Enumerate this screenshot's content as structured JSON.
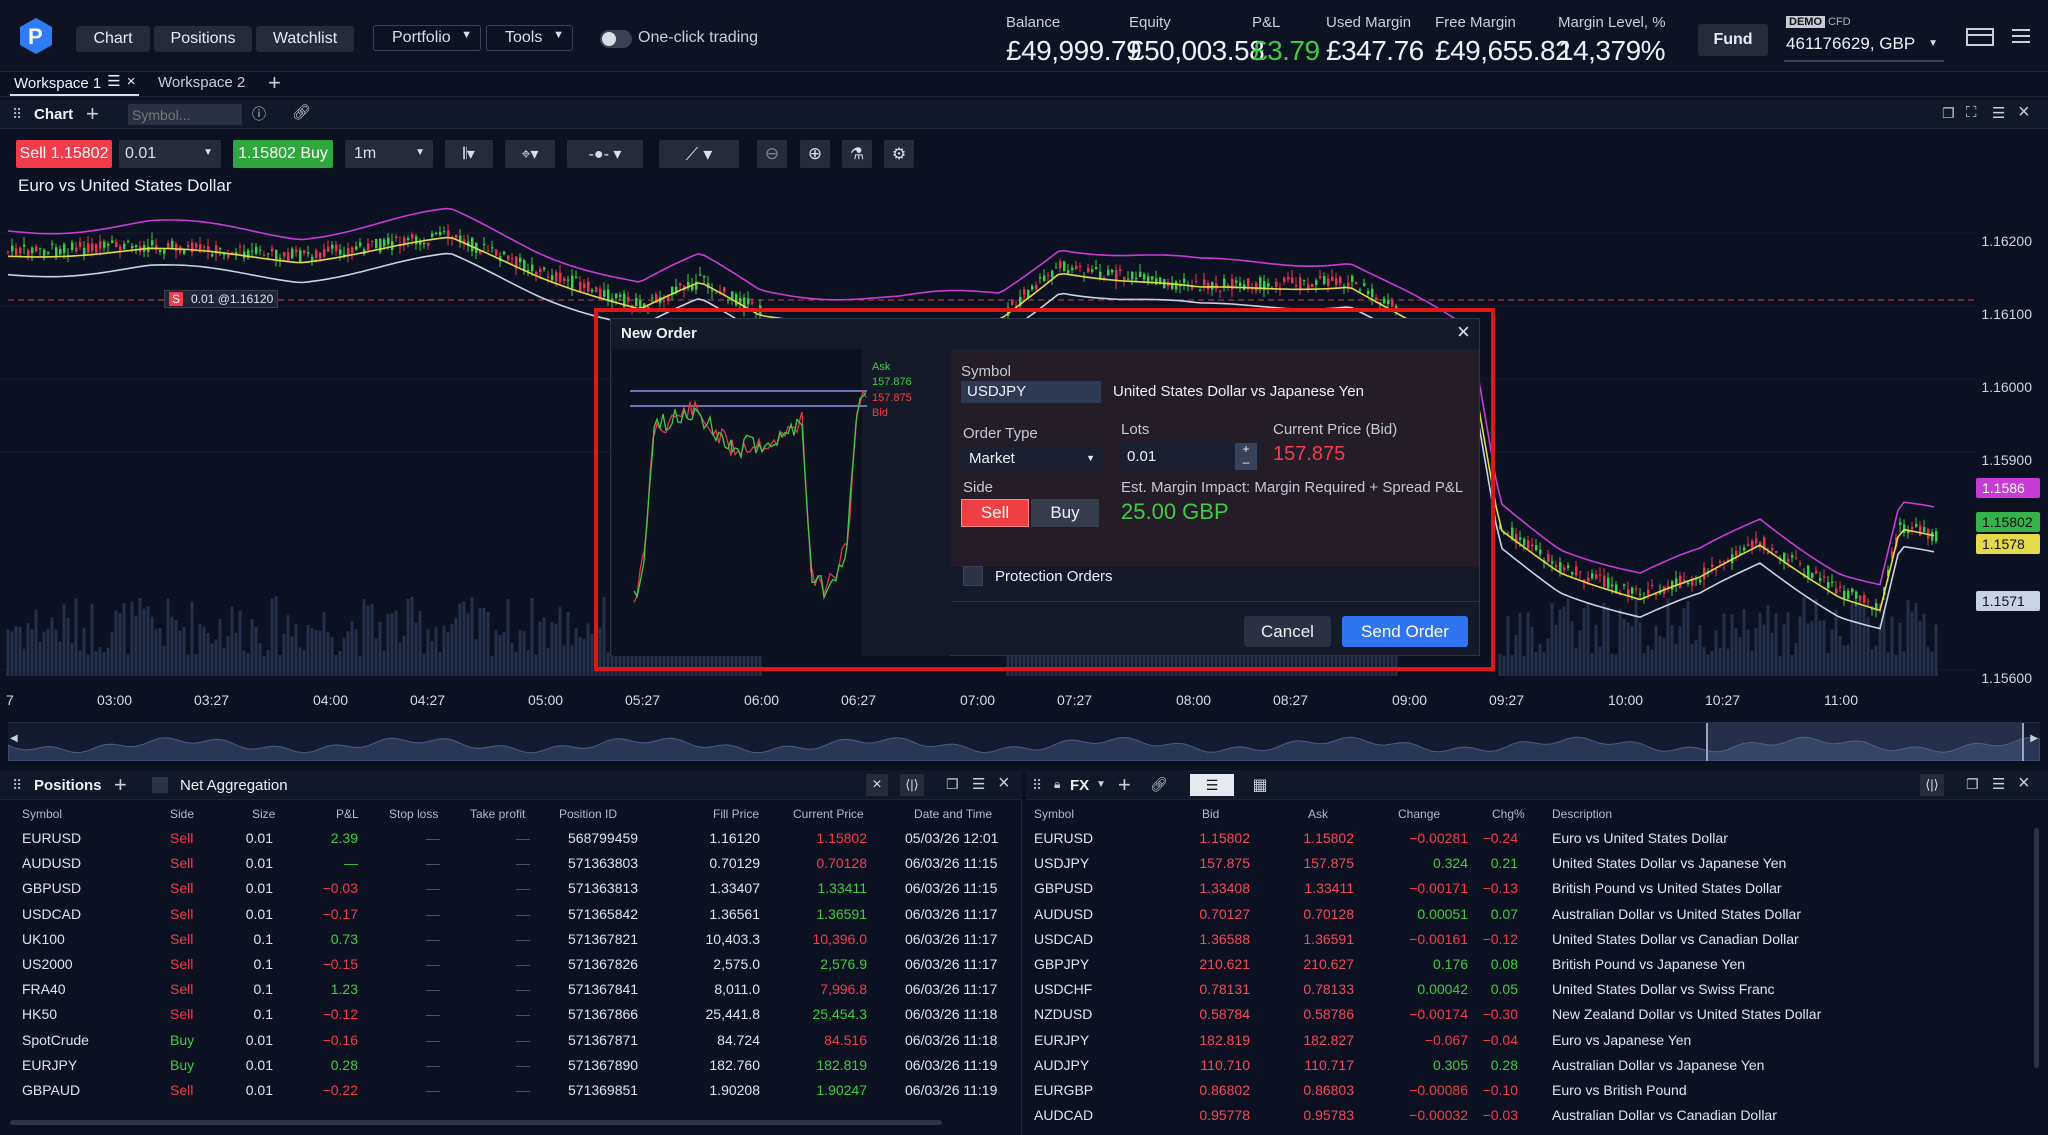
{
  "topbar": {
    "nav": [
      "Chart",
      "Positions",
      "Watchlist"
    ],
    "portfolio": "Portfolio",
    "tools": "Tools",
    "one_click": "One-click trading",
    "balance_label": "Balance",
    "balance": "£49,999.79",
    "equity_label": "Equity",
    "equity": "£50,003.58",
    "pnl_label": "P&L",
    "pnl": "£3.79",
    "used_margin_label": "Used Margin",
    "used_margin": "£347.76",
    "free_margin_label": "Free Margin",
    "free_margin": "£49,655.82",
    "margin_level_label": "Margin Level, %",
    "margin_level": "14,379%",
    "fund": "Fund",
    "demo": "DEMO",
    "cfd": "CFD",
    "account": "461176629, GBP"
  },
  "workspaces": [
    "Workspace 1",
    "Workspace 2"
  ],
  "chart_panel": {
    "title": "Chart",
    "symbol_placeholder": "Symbol...",
    "sell": "Sell 1.15802",
    "lots": "0.01",
    "buy": "1.15802 Buy",
    "timeframe": "1m",
    "instrument": "Euro vs United States Dollar",
    "position_tag": "0.01 @1.16120",
    "position_marker": "S",
    "yticks": [
      "1.16200",
      "1.16100",
      "1.16000",
      "1.15900",
      "1.15600"
    ],
    "price_tags": [
      {
        "v": "1.1586",
        "color": "#c83cd6"
      },
      {
        "v": "1.15802",
        "color": "#35b34a"
      },
      {
        "v": "1.1578",
        "color": "#e3d94a"
      },
      {
        "v": "1.1571",
        "color": "#c8d4e6"
      }
    ],
    "xticks": [
      "7",
      "03:00",
      "03:27",
      "04:00",
      "04:27",
      "05:00",
      "05:27",
      "06:00",
      "06:27",
      "07:00",
      "07:27",
      "08:00",
      "08:27",
      "09:00",
      "09:27",
      "10:00",
      "10:27",
      "11:00"
    ]
  },
  "modal": {
    "title": "New Order",
    "ask_label": "Ask",
    "ask": "157.876",
    "bid": "157.875",
    "bid_label": "Bid",
    "symbol_label": "Symbol",
    "symbol": "USDJPY",
    "symbol_desc": "United States Dollar vs Japanese Yen",
    "order_type_label": "Order Type",
    "order_type": "Market",
    "lots_label": "Lots",
    "lots": "0.01",
    "price_label": "Current Price (Bid)",
    "price": "157.875",
    "side_label": "Side",
    "sell": "Sell",
    "buy": "Buy",
    "margin_label": "Est. Margin Impact: Margin Required + Spread P&L",
    "margin": "25.00 GBP",
    "protection": "Protection Orders",
    "cancel": "Cancel",
    "send": "Send Order"
  },
  "positions": {
    "title": "Positions",
    "net": "Net Aggregation",
    "headers": [
      "Symbol",
      "Side",
      "Size",
      "P&L",
      "Stop loss",
      "Take profit",
      "Position ID",
      "Fill Price",
      "Current Price",
      "Date and Time"
    ],
    "rows": [
      [
        "EURUSD",
        "Sell",
        "0.01",
        "2.39",
        "—",
        "—",
        "568799459",
        "1.16120",
        "1.15802",
        "05/03/26 12:01"
      ],
      [
        "AUDUSD",
        "Sell",
        "0.01",
        "—",
        "—",
        "—",
        "571363803",
        "0.70129",
        "0.70128",
        "06/03/26 11:15"
      ],
      [
        "GBPUSD",
        "Sell",
        "0.01",
        "−0.03",
        "—",
        "—",
        "571363813",
        "1.33407",
        "1.33411",
        "06/03/26 11:15"
      ],
      [
        "USDCAD",
        "Sell",
        "0.01",
        "−0.17",
        "—",
        "—",
        "571365842",
        "1.36561",
        "1.36591",
        "06/03/26 11:17"
      ],
      [
        "UK100",
        "Sell",
        "0.1",
        "0.73",
        "—",
        "—",
        "571367821",
        "10,403.3",
        "10,396.0",
        "06/03/26 11:17"
      ],
      [
        "US2000",
        "Sell",
        "0.1",
        "−0.15",
        "—",
        "—",
        "571367826",
        "2,575.0",
        "2,576.9",
        "06/03/26 11:17"
      ],
      [
        "FRA40",
        "Sell",
        "0.1",
        "1.23",
        "—",
        "—",
        "571367841",
        "8,011.0",
        "7,996.8",
        "06/03/26 11:17"
      ],
      [
        "HK50",
        "Sell",
        "0.1",
        "−0.12",
        "—",
        "—",
        "571367866",
        "25,441.8",
        "25,454.3",
        "06/03/26 11:18"
      ],
      [
        "SpotCrude",
        "Buy",
        "0.01",
        "−0.16",
        "—",
        "—",
        "571367871",
        "84.724",
        "84.516",
        "06/03/26 11:18"
      ],
      [
        "EURJPY",
        "Buy",
        "0.01",
        "0.28",
        "—",
        "—",
        "571367890",
        "182.760",
        "182.819",
        "06/03/26 11:19"
      ],
      [
        "GBPAUD",
        "Sell",
        "0.01",
        "−0.22",
        "—",
        "—",
        "571369851",
        "1.90208",
        "1.90247",
        "06/03/26 11:19"
      ]
    ]
  },
  "fx": {
    "title": "FX",
    "headers": [
      "Symbol",
      "Bid",
      "Ask",
      "Change",
      "Chg%",
      "Description"
    ],
    "rows": [
      [
        "EURUSD",
        "1.15802",
        "1.15802",
        "−0.00281",
        "−0.24",
        "Euro vs United States Dollar"
      ],
      [
        "USDJPY",
        "157.875",
        "157.875",
        "0.324",
        "0.21",
        "United States Dollar vs Japanese Yen"
      ],
      [
        "GBPUSD",
        "1.33408",
        "1.33411",
        "−0.00171",
        "−0.13",
        "British Pound vs United States Dollar"
      ],
      [
        "AUDUSD",
        "0.70127",
        "0.70128",
        "0.00051",
        "0.07",
        "Australian Dollar vs United States Dollar"
      ],
      [
        "USDCAD",
        "1.36588",
        "1.36591",
        "−0.00161",
        "−0.12",
        "United States Dollar vs Canadian Dollar"
      ],
      [
        "GBPJPY",
        "210.621",
        "210.627",
        "0.176",
        "0.08",
        "British Pound vs Japanese Yen"
      ],
      [
        "USDCHF",
        "0.78131",
        "0.78133",
        "0.00042",
        "0.05",
        "United States Dollar vs Swiss Franc"
      ],
      [
        "NZDUSD",
        "0.58784",
        "0.58786",
        "−0.00174",
        "−0.30",
        "New Zealand Dollar vs United States Dollar"
      ],
      [
        "EURJPY",
        "182.819",
        "182.827",
        "−0.067",
        "−0.04",
        "Euro vs Japanese Yen"
      ],
      [
        "AUDJPY",
        "110.710",
        "110.717",
        "0.305",
        "0.28",
        "Australian Dollar vs Japanese Yen"
      ],
      [
        "EURGBP",
        "0.86802",
        "0.86803",
        "−0.00086",
        "−0.10",
        "Euro vs British Pound"
      ],
      [
        "AUDCAD",
        "0.95778",
        "0.95783",
        "−0.00032",
        "−0.03",
        "Australian Dollar vs Canadian Dollar"
      ]
    ]
  }
}
